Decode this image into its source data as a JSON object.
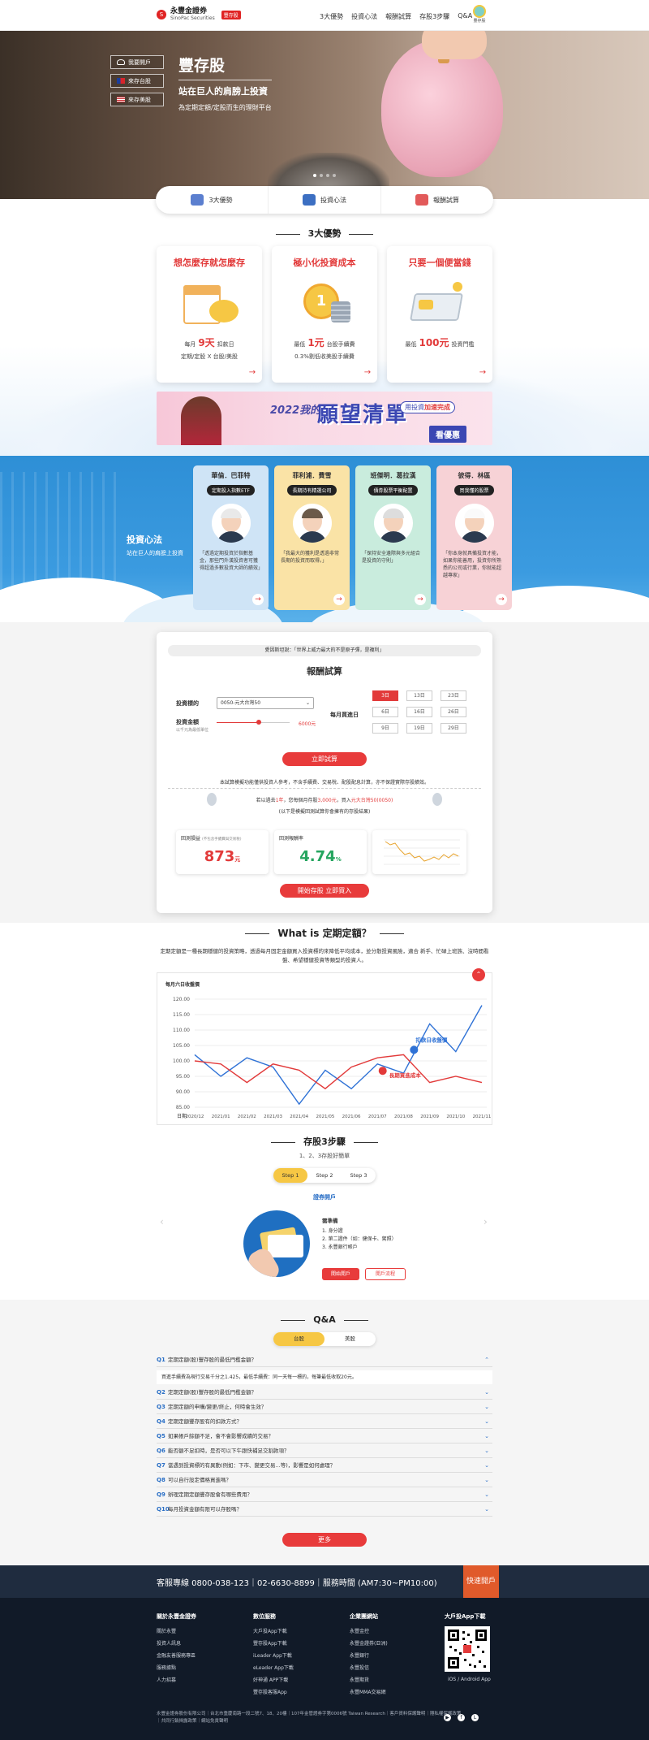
{
  "header": {
    "brand_cn": "永豐金證券",
    "brand_en": "SinoPac Securities",
    "brand_tag": "豐存股",
    "nav": [
      "3大優勢",
      "投資心法",
      "報酬試算",
      "存股3步驟",
      "Q&A"
    ],
    "user_label": "豐存股"
  },
  "hero": {
    "buttons": [
      "我要開戶",
      "來存台股",
      "來存美股"
    ],
    "title": "豐存股",
    "subtitle": "站在巨人的肩膀上投資",
    "desc": "為定期定額/定股而生的理財平台"
  },
  "tabs": [
    "3大優勢",
    "投資心法",
    "報酬試算"
  ],
  "advantages": {
    "section_title": "3大優勢",
    "cards": [
      {
        "title": "想怎麼存就怎麼存",
        "pre": "每月",
        "hl": "9天",
        "post": "扣款日",
        "line2": "定期/定股 X 台股/美股"
      },
      {
        "title": "極小化投資成本",
        "pre": "最低",
        "hl": "1元",
        "post": "台股手續費",
        "line2": "0.3%剔低收美股手續費"
      },
      {
        "title": "只要一個便當錢",
        "pre": "最低",
        "hl": "100元",
        "post": "投資門檻",
        "line2": ""
      }
    ]
  },
  "banner": {
    "year": "2022我的",
    "big": "願望清單",
    "pill_pre": "用投資",
    "pill_hl": "加速完成",
    "cta": "看優惠"
  },
  "invest": {
    "title": "投資心法",
    "sub": "站在巨人的肩膀上投資",
    "people": [
      {
        "name": "華倫．巴菲特",
        "role": "定期投入指數ETF",
        "quote": "「透過定期投資於指數基金，那些門外漢投資者可獲得超過多數投資大師的績效」"
      },
      {
        "name": "菲利浦．費雪",
        "role": "長期持有精選公司",
        "quote": "「我最大的獲利是透過非常長期的投資而取得。」"
      },
      {
        "name": "班傑明．葛拉漢",
        "role": "債券股票平衡配置",
        "quote": "「保持安全邊際與多元組合是投資的守則」"
      },
      {
        "name": "彼得．林區",
        "role": "買我懂的股票",
        "quote": "「你本身就具備投資才能，如果你能善用，投資你所熟悉的公司或行業，你就能超越專家」"
      }
    ]
  },
  "calc": {
    "quote": "愛因斯坦說：「世界上威力最大的不是原子彈，是複利」",
    "title": "報酬試算",
    "stock_label": "投資標的",
    "stock_value": "0050-元大台灣50",
    "amount_label": "投資金額",
    "amount_sub": "以千元為最低單位",
    "amount_value": "6000元",
    "day_label": "每月買進日",
    "days": [
      "3日",
      "13日",
      "23日",
      "6日",
      "16日",
      "26日",
      "9日",
      "19日",
      "29日"
    ],
    "calc_btn": "立即試算",
    "note": "本試算模擬功能僅供投資人參考，不含手續費、交易稅、配股配息計算，亦不保證實際存股績效。",
    "result_line": {
      "pre": "若以過去",
      "y": "1年",
      "mid": "，您每個月存股",
      "amt": "3,000元",
      "mid2": "，買入",
      "stk": "元大台灣50(0050)"
    },
    "result_sub": "(以下是模擬回測試算你會擁有的存股結果)",
    "profit_label": "回測損益",
    "profit_note": "(不包含手續費與交易稅)",
    "profit_value": "873",
    "profit_unit": "元",
    "rate_label": "回測報酬率",
    "rate_value": "4.74",
    "rate_unit": "%",
    "open_btn": "開始存股 立即買入"
  },
  "what": {
    "title": "What is 定期定額？",
    "text": "定期定額是一種長期穩健的投資策略，透過每月固定金額買入投資標的來降低平均成本，並分散投資風險，適合 新手、忙碌上班族、沒時間看盤、希望穩健投資等類型的投資人。"
  },
  "chart_data": {
    "type": "line",
    "title": "每月六日收盤價",
    "categories": [
      "2020/12",
      "2021/01",
      "2021/02",
      "2021/03",
      "2021/04",
      "2021/05",
      "2021/06",
      "2021/07",
      "2021/08",
      "2021/09",
      "2021/10",
      "2021/11"
    ],
    "xlabel": "日期",
    "ylim": [
      85,
      120
    ],
    "yticks": [
      85,
      90,
      95,
      100,
      105,
      110,
      115,
      120
    ],
    "series": [
      {
        "name": "扣款日收盤價",
        "color": "#2f72d6",
        "values": [
          102,
          95,
          101,
          98,
          86,
          97,
          91,
          99,
          96,
          112,
          103,
          118
        ]
      },
      {
        "name": "長期買進成本",
        "color": "#e23a3a",
        "values": [
          100,
          99,
          93,
          99,
          97,
          91,
          98,
          101,
          102,
          93,
          95,
          93
        ]
      }
    ]
  },
  "steps": {
    "title": "存股3步驟",
    "sub": "1、2、3存股好簡單",
    "tabs": [
      "Step 1",
      "Step 2",
      "Step 3"
    ],
    "step_title": "證券開戶",
    "need": "需準備",
    "items": [
      "1. 身分證",
      "2. 第二證件（如：健保卡、駕照）",
      "3. 永豐銀行帳戶"
    ],
    "btn1": "開始開戶",
    "btn2": "開戶流程"
  },
  "qa": {
    "title": "Q&A",
    "tabs": [
      "台股",
      "美股"
    ],
    "items": [
      "定期定額(股)豐存股的最低門檻金額？",
      "定期定額(股)豐存股的最低門檻金額？",
      "定期定額的申購/變更/終止，何時會生效？",
      "定期定額豐存股有的扣款方式？",
      "如果帳戶餘額不足，會不會影響成績的交易？",
      "能否額不足扣時，是否可以下午跟快補足交割款項？",
      "當遇到投資標的有異動(例如：下市、變更交易...等)，影響是如何處理？",
      "可以自行設定價格買進嗎？",
      "辦理定期定額豐存股會有哪些費用？",
      "每月投資金額有限可以存股嗎？"
    ],
    "answer": "買進手續費為現行交易千分之1.425，最低手續費：同一天每一標的，每筆最低收取20元。",
    "more": "更多"
  },
  "footer": {
    "hotline": "客服專線 0800-038-123｜02-6630-8899｜服務時間 (AM7:30~PM10:00)",
    "quick": "快速開戶",
    "cols": [
      {
        "h": "關於永豐金證券",
        "items": [
          "關於永豐",
          "投資人訊息",
          "金融友善服務專區",
          "服務據點",
          "人力招募"
        ]
      },
      {
        "h": "數位服務",
        "items": [
          "大戶投App下載",
          "豐存股App下載",
          "iLeader App下載",
          "eLeader App下載",
          "好神通 APP下載",
          "豐存股客服App"
        ]
      },
      {
        "h": "企業團網站",
        "items": [
          "永豐金控",
          "永豐金證券(亞洲)",
          "永豐銀行",
          "永豐投信",
          "永豐期貨",
          "永豐MMA交易網"
        ]
      }
    ],
    "app_title": "大戶投App下載",
    "app_sub": "iOS / Android App",
    "legal": "永豐金證券股份有限公司｜台北市重慶南路一段二號7、18、20樓｜107年金管證券字第0006號 Taiwan Research｜客戶資料保護聲明｜隱私權保護政策｜共同行銷揭露政策｜網站免責聲明"
  }
}
